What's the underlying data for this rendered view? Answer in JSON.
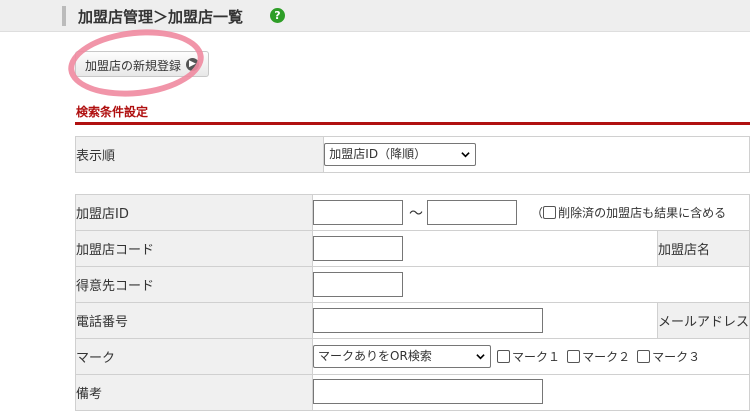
{
  "header": {
    "title": "加盟店管理＞加盟店一覧"
  },
  "actions": {
    "new_label": "加盟店の新規登録"
  },
  "search": {
    "title": "検索条件設定",
    "sort": {
      "label": "表示順",
      "selected": "加盟店ID（降順）"
    },
    "rows": {
      "store_id": {
        "label": "加盟店ID",
        "tilde": "～",
        "note_open": "（",
        "note_text": "削除済の加盟店も結果に含める"
      },
      "store_code": {
        "label": "加盟店コード",
        "right_label": "加盟店名"
      },
      "customer_code": {
        "label": "得意先コード"
      },
      "phone": {
        "label": "電話番号",
        "right_label": "メールアドレス"
      },
      "mark": {
        "label": "マーク",
        "selected": "マークありをOR検索",
        "options": [
          "マーク１",
          "マーク２",
          "マーク３"
        ]
      },
      "remarks": {
        "label": "備考"
      }
    }
  }
}
